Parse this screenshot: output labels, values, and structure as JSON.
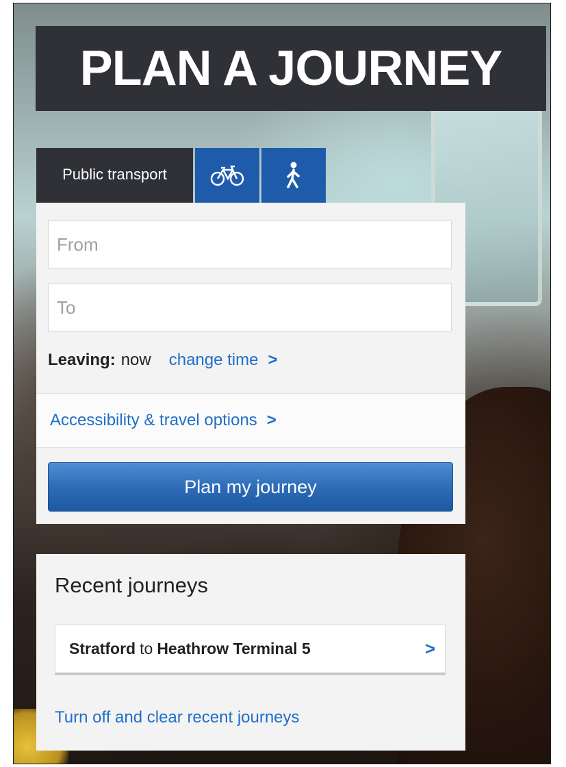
{
  "title": "PLAN A JOURNEY",
  "tabs": {
    "public_transport": "Public transport",
    "cycle_icon": "bicycle-icon",
    "walk_icon": "walking-person-icon"
  },
  "form": {
    "from_placeholder": "From",
    "to_placeholder": "To",
    "leaving_label": "Leaving:",
    "leaving_value": "now",
    "change_time": "change time",
    "accessibility": "Accessibility & travel options",
    "chevron": ">",
    "plan_button": "Plan my journey"
  },
  "recent": {
    "heading": "Recent journeys",
    "items": [
      {
        "from": "Stratford",
        "connector": "to",
        "to": "Heathrow Terminal 5"
      }
    ],
    "clear_link": "Turn off and clear recent journeys"
  },
  "colors": {
    "banner": "#2f3137",
    "tab_active": "#2f3137",
    "tab_inactive": "#1f5bab",
    "link": "#1f6fc7",
    "button": "#2e6cb8"
  }
}
